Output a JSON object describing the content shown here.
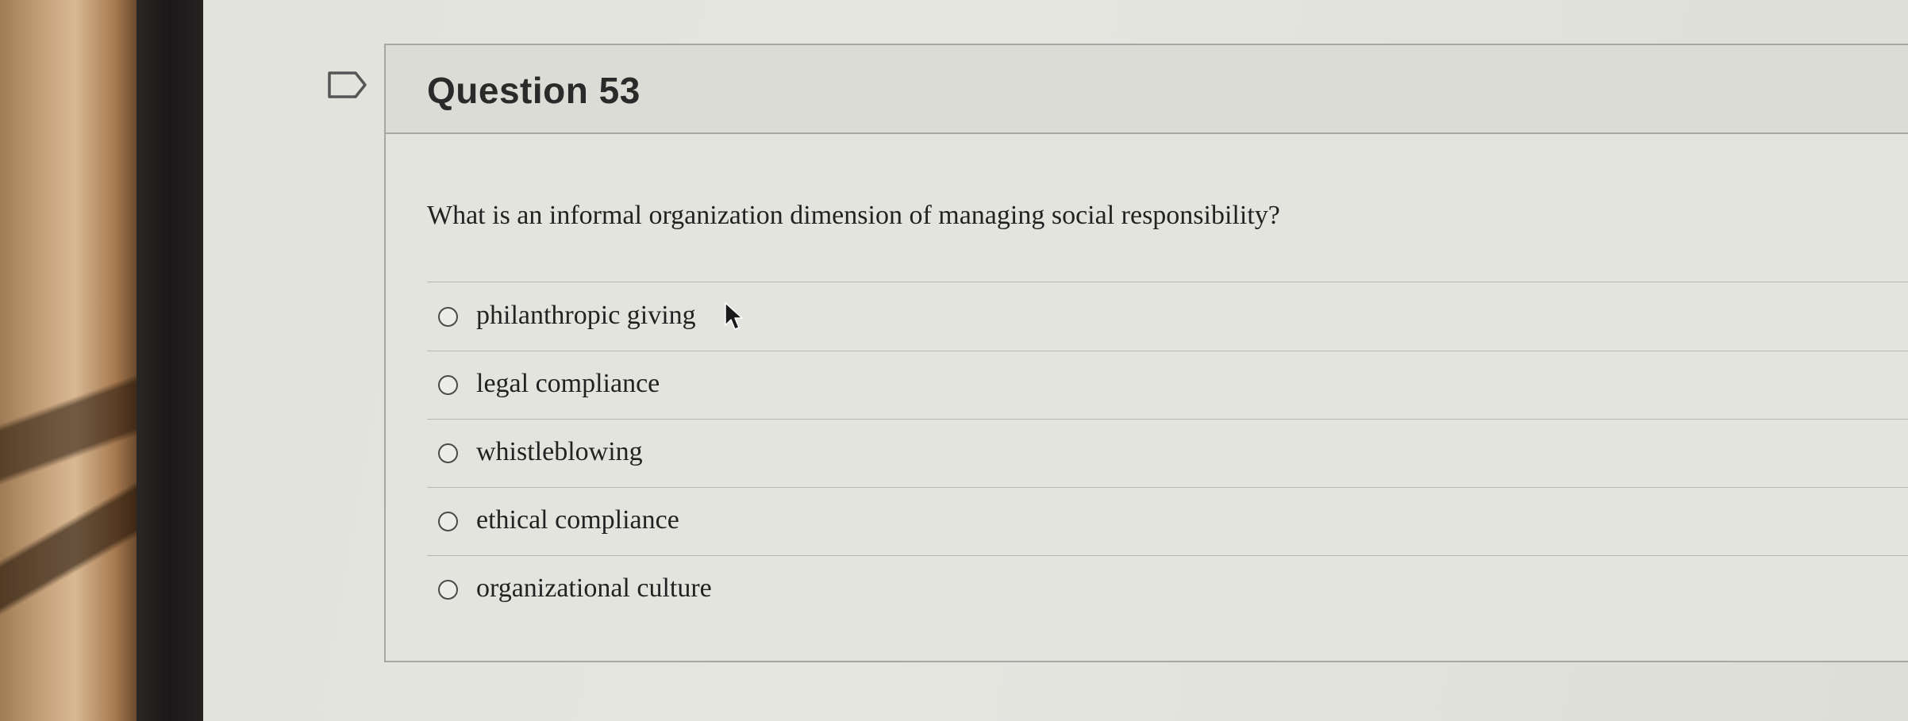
{
  "question": {
    "title": "Question 53",
    "text": "What is an informal organization dimension of managing social responsibility?",
    "answers": [
      {
        "label": "philanthropic giving",
        "selected": false
      },
      {
        "label": "legal compliance",
        "selected": false
      },
      {
        "label": "whistleblowing",
        "selected": false
      },
      {
        "label": "ethical compliance",
        "selected": false
      },
      {
        "label": "organizational culture",
        "selected": false
      }
    ]
  },
  "icons": {
    "flag": "flag-question-icon",
    "cursor": "mouse-pointer-icon",
    "radio": "radio-button-icon"
  },
  "colors": {
    "screen_bg": "#e4e4df",
    "border": "#a6a6a2",
    "text": "#222222"
  }
}
